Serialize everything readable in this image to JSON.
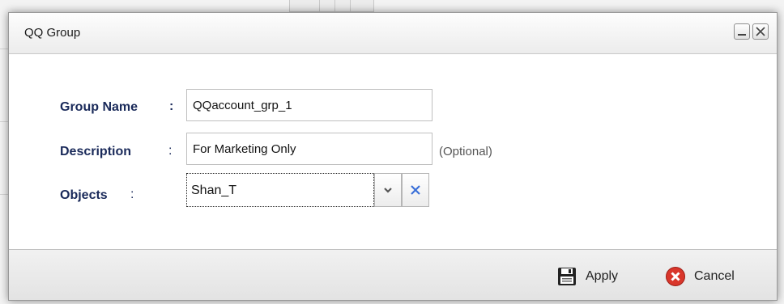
{
  "dialog": {
    "title": "QQ Group",
    "minimize_icon": "minimize-icon",
    "close_icon": "close-icon"
  },
  "form": {
    "group_name": {
      "label": "Group Name",
      "colon": ":",
      "value": "QQaccount_grp_1"
    },
    "description": {
      "label": "Description",
      "colon": ":",
      "value": "For Marketing Only",
      "hint": "(Optional)"
    },
    "objects": {
      "label": "Objects",
      "colon": ":",
      "value": "Shan_T",
      "dropdown_icon": "chevron-down-icon",
      "clear_icon": "clear-x-icon"
    }
  },
  "footer": {
    "apply_label": "Apply",
    "apply_icon": "save-disk-icon",
    "cancel_label": "Cancel",
    "cancel_icon": "cancel-circle-icon"
  },
  "colors": {
    "label_text": "#1a2a5a",
    "cancel_icon": "#d9362b",
    "clear_icon": "#3a6fd8"
  }
}
